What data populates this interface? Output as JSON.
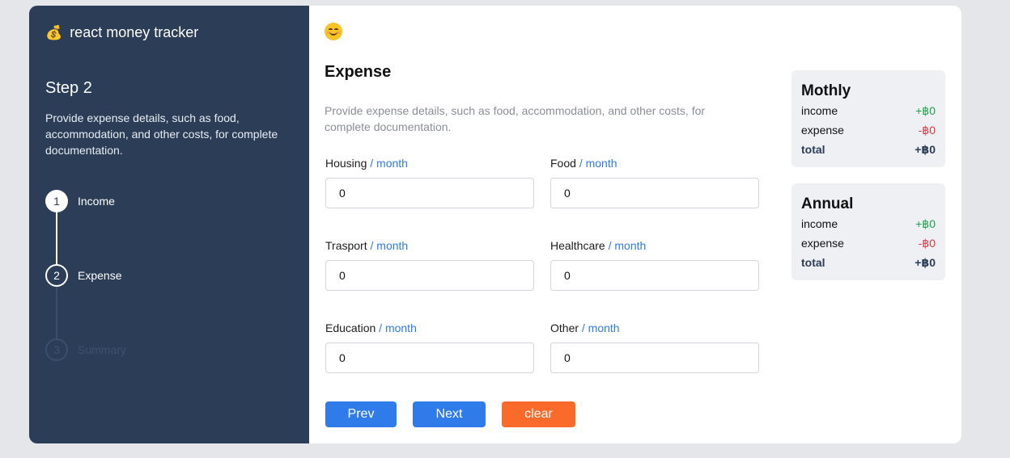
{
  "sidebar": {
    "brand_icon": "💰",
    "brand": "react money tracker",
    "step_title": "Step 2",
    "step_desc": "Provide expense details, such as food, accommodation, and other costs, for complete documentation.",
    "steps": [
      {
        "number": "1",
        "label": "Income",
        "state": "done"
      },
      {
        "number": "2",
        "label": "Expense",
        "state": "active"
      },
      {
        "number": "3",
        "label": "Summary",
        "state": "pending"
      }
    ]
  },
  "main": {
    "emoji_icon": "smiling-face-icon",
    "title": "Expense",
    "description": "Provide expense details, such as food, accommodation, and other costs, for complete documentation.",
    "fields": [
      {
        "label": "Housing",
        "unit": "/ month",
        "value": "0"
      },
      {
        "label": "Food",
        "unit": "/ month",
        "value": "0"
      },
      {
        "label": "Trasport",
        "unit": "/ month",
        "value": "0"
      },
      {
        "label": "Healthcare",
        "unit": "/ month",
        "value": "0"
      },
      {
        "label": "Education",
        "unit": "/ month",
        "value": "0"
      },
      {
        "label": "Other",
        "unit": "/ month",
        "value": "0"
      }
    ],
    "buttons": {
      "prev": "Prev",
      "next": "Next",
      "clear": "clear"
    }
  },
  "summary": {
    "monthly": {
      "title": "Mothly",
      "income_label": "income",
      "income_value": "+฿0",
      "expense_label": "expense",
      "expense_value": "-฿0",
      "total_label": "total",
      "total_value": "+฿0"
    },
    "annual": {
      "title": "Annual",
      "income_label": "income",
      "income_value": "+฿0",
      "expense_label": "expense",
      "expense_value": "-฿0",
      "total_label": "total",
      "total_value": "+฿0"
    }
  },
  "colors": {
    "sidebar_bg": "#2b3d57",
    "accent_blue": "#2f7be9",
    "clear_orange": "#f96a2b",
    "income_green": "#1aa34a",
    "expense_red": "#e5343d"
  }
}
